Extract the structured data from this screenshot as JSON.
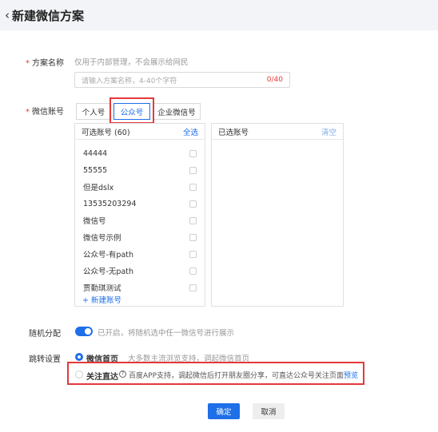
{
  "header": {
    "title": "新建微信方案"
  },
  "plan_name": {
    "label": "方案名称",
    "hint": "仅用于内部管理，不会展示给网民",
    "placeholder": "请输入方案名称，4-40个字符",
    "counter": "0/40"
  },
  "wechat_account": {
    "label": "微信账号",
    "tabs": [
      "个人号",
      "公众号",
      "企业微信号"
    ],
    "active_tab": "公众号",
    "available": {
      "title": "可选账号 (60)",
      "select_all": "全选",
      "items": [
        "44444",
        "55555",
        "但是dslx",
        "13535203294",
        "微信号",
        "微信号示例",
        "公众号-有path",
        "公众号-无path",
        "贾勤琪测试"
      ],
      "add_link": "+ 新建账号"
    },
    "selected": {
      "title": "已选账号",
      "clear": "清空"
    }
  },
  "random_assign": {
    "label": "随机分配",
    "enabled": true,
    "text": "已开启，将随机选中任一微信号进行展示"
  },
  "jump_settings": {
    "label": "跳转设置",
    "option1": {
      "label": "微信首页",
      "desc": "大多数主流浏览支持，调起微信首页"
    },
    "option2": {
      "label": "关注直达",
      "desc": "百度APP支持，调起微信后打开朋友圈分享，可直达公众号关注页面",
      "link": "预览"
    }
  },
  "actions": {
    "confirm": "确定",
    "cancel": "取消"
  },
  "colors": {
    "accent": "#1e6fe8",
    "highlight": "#e5383b",
    "required": "#e53935"
  }
}
